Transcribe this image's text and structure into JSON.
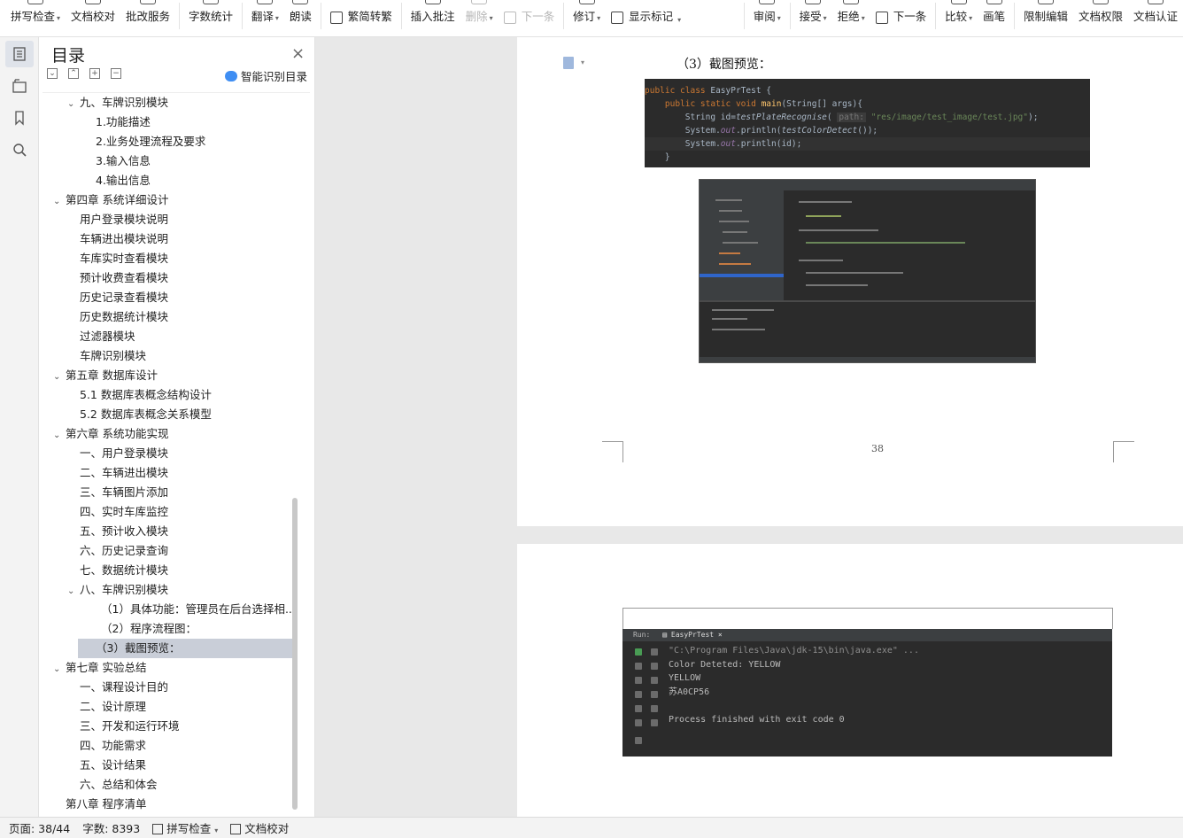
{
  "ribbon": {
    "spellcheck": "拼写检查",
    "proofread": "文档校对",
    "correction_service": "批改服务",
    "word_count": "字数统计",
    "translate": "翻译",
    "read_aloud": "朗读",
    "simp_trad": "繁简转繁",
    "insert_comment": "插入批注",
    "delete": "删除",
    "next_comment": "下一条",
    "revise": "修订",
    "show_markup": "显示标记",
    "review": "审阅",
    "accept": "接受",
    "reject": "拒绝",
    "next_change": "下一条",
    "compare": "比较",
    "pen": "画笔",
    "restrict_edit": "限制编辑",
    "doc_permission": "文档权限",
    "doc_cert": "文档认证"
  },
  "toc": {
    "title": "目录",
    "smart_toc": "智能识别目录",
    "items": [
      {
        "label": "九、车牌识别模块",
        "level": 2,
        "expanded": true
      },
      {
        "label": "1.功能描述",
        "level": 3
      },
      {
        "label": "2.业务处理流程及要求",
        "level": 3
      },
      {
        "label": "3.输入信息",
        "level": 3
      },
      {
        "label": "4.输出信息",
        "level": 3
      },
      {
        "label": "第四章  系统详细设计",
        "level": 1,
        "expanded": true
      },
      {
        "label": "用户登录模块说明",
        "level": 2
      },
      {
        "label": "车辆进出模块说明",
        "level": 2
      },
      {
        "label": "车库实时查看模块",
        "level": 2
      },
      {
        "label": "预计收费查看模块",
        "level": 2
      },
      {
        "label": "历史记录查看模块",
        "level": 2
      },
      {
        "label": "历史数据统计模块",
        "level": 2
      },
      {
        "label": "过滤器模块",
        "level": 2
      },
      {
        "label": "车牌识别模块",
        "level": 2
      },
      {
        "label": "第五章  数据库设计",
        "level": 1,
        "expanded": true
      },
      {
        "label": "5.1 数据库表概念结构设计",
        "level": 2
      },
      {
        "label": "5.2 数据库表概念关系模型",
        "level": 2
      },
      {
        "label": "第六章  系统功能实现",
        "level": 1,
        "expanded": true
      },
      {
        "label": "一、用户登录模块",
        "level": 2
      },
      {
        "label": "二、车辆进出模块",
        "level": 2
      },
      {
        "label": "三、车辆图片添加",
        "level": 2
      },
      {
        "label": "四、实时车库监控",
        "level": 2
      },
      {
        "label": "五、预计收入模块",
        "level": 2
      },
      {
        "label": "六、历史记录查询",
        "level": 2
      },
      {
        "label": "七、数据统计模块",
        "level": 2
      },
      {
        "label": "八、车牌识别模块",
        "level": 2,
        "expanded": true
      },
      {
        "label": "（1）具体功能：管理员在后台选择相...",
        "level": 3
      },
      {
        "label": "（2）程序流程图：",
        "level": 3
      },
      {
        "label": "（3）截图预览：",
        "level": 3,
        "selected": true
      },
      {
        "label": "第七章  实验总结",
        "level": 1,
        "expanded": true
      },
      {
        "label": "一、课程设计目的",
        "level": 2
      },
      {
        "label": "二、设计原理",
        "level": 2
      },
      {
        "label": "三、开发和运行环境",
        "level": 2
      },
      {
        "label": "四、功能需求",
        "level": 2
      },
      {
        "label": "五、设计结果",
        "level": 2
      },
      {
        "label": "六、总结和体会",
        "level": 2
      },
      {
        "label": "第八章  程序清单",
        "level": 1
      }
    ]
  },
  "doc": {
    "heading": "（3）截图预览：",
    "page_number": "38",
    "code_lines": {
      "l1a": "public class ",
      "l1b": "EasyPrTest {",
      "l2a": "    public static void ",
      "l2b": "main",
      "l2c": "(String[] args){",
      "l3a": "        String id=",
      "l3b": "testPlateRecognise",
      "l3c": "( ",
      "l3d": "path:",
      "l3e": " \"res/image/test_image/test.jpg\"",
      "l3f": ");",
      "l4a": "        System.",
      "l4b": "out",
      "l4c": ".println(",
      "l4d": "testColorDetect",
      "l4e": "());",
      "l5a": "        System.",
      "l5b": "out",
      "l5c": ".println(id);",
      "l6": "    }"
    },
    "console": {
      "run_label": "Run:",
      "tab": "EasyPrTest",
      "lines": [
        "\"C:\\Program Files\\Java\\jdk-15\\bin\\java.exe\" ...",
        "Color Deteted: YELLOW",
        "YELLOW",
        "苏A0CP56",
        "",
        "Process finished with exit code 0"
      ]
    }
  },
  "status": {
    "page": "页面: 38/44",
    "words": "字数: 8393",
    "spellcheck": "拼写检查",
    "proofread": "文档校对"
  }
}
